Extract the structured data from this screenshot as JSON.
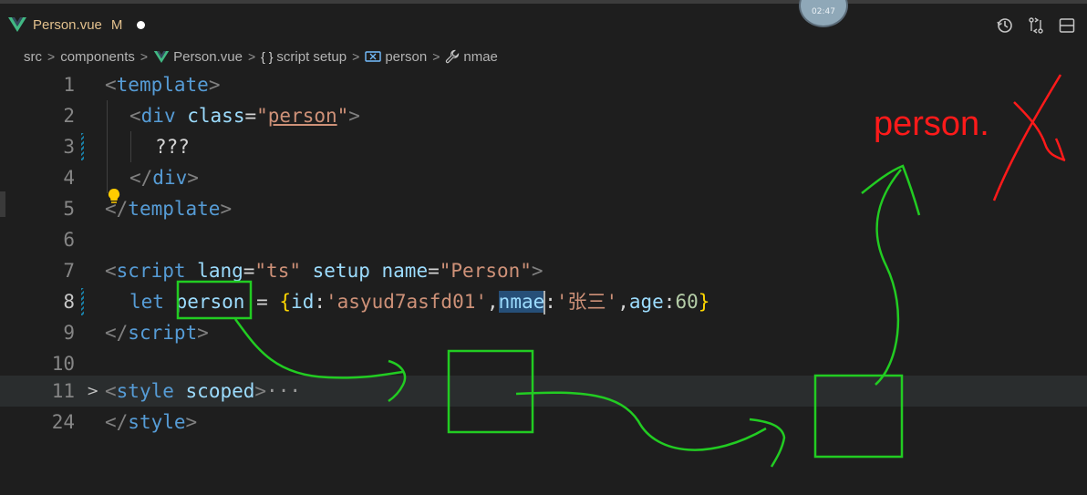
{
  "tab": {
    "filename": "Person.vue",
    "status": "M"
  },
  "overlay": {
    "time": "02:47"
  },
  "breadcrumb": {
    "items": [
      {
        "label": "src",
        "icon": ""
      },
      {
        "label": "components",
        "icon": ""
      },
      {
        "label": "Person.vue",
        "icon": "vue-icon"
      },
      {
        "label": "script setup",
        "icon": "braces-icon"
      },
      {
        "label": "person",
        "icon": "variable-icon"
      },
      {
        "label": "nmae",
        "icon": "wrench-icon"
      }
    ]
  },
  "toolbar_icons": [
    "history-icon",
    "compare-changes-icon",
    "split-editor-icon"
  ],
  "editor": {
    "line_numbers": [
      "1",
      "2",
      "3",
      "4",
      "5",
      "6",
      "7",
      "8",
      "9",
      "10",
      "11",
      "24"
    ],
    "lines": {
      "l1": {
        "lt": "<",
        "tag": "template",
        "gt": ">"
      },
      "l2": {
        "lt": "<",
        "tag": "div",
        "attr": "class",
        "eq": "=",
        "q1": "\"",
        "val": "person",
        "q2": "\"",
        "gt": ">"
      },
      "l3": {
        "text": "???"
      },
      "l4": {
        "lt": "</",
        "tag": "div",
        "gt": ">"
      },
      "l5": {
        "lt": "</",
        "tag": "template",
        "gt": ">"
      },
      "l7": {
        "lt": "<",
        "tag": "script",
        "a1": "lang",
        "v1": "\"ts\"",
        "a2": "setup",
        "a3": "name",
        "v3": "\"Person\"",
        "gt": ">"
      },
      "l8": {
        "kw": "let",
        "var": "person",
        "op": " = ",
        "ob": "{",
        "k1": "id",
        "v1": "'asyud7asfd01'",
        "k2": "nmae",
        "v2": "'张三'",
        "k3": "age",
        "v3": "60",
        "cb": "}"
      },
      "l9": {
        "lt": "</",
        "tag": "script",
        "gt": ">"
      },
      "l11": {
        "lt": "<",
        "tag": "style",
        "attr": "scoped",
        "gt": ">",
        "ellipsis": "···"
      },
      "l24": {
        "lt": "</",
        "tag": "style",
        "gt": ">"
      }
    }
  },
  "annotation": {
    "text": "person.",
    "color": "#ff1a1a",
    "box_color": "#22cc22"
  },
  "colors": {
    "background": "#1e1e1e",
    "tag": "#569cd6",
    "attribute": "#9cdcfe",
    "string": "#ce9178",
    "number": "#b5cea8",
    "bracket": "#ffd700"
  }
}
